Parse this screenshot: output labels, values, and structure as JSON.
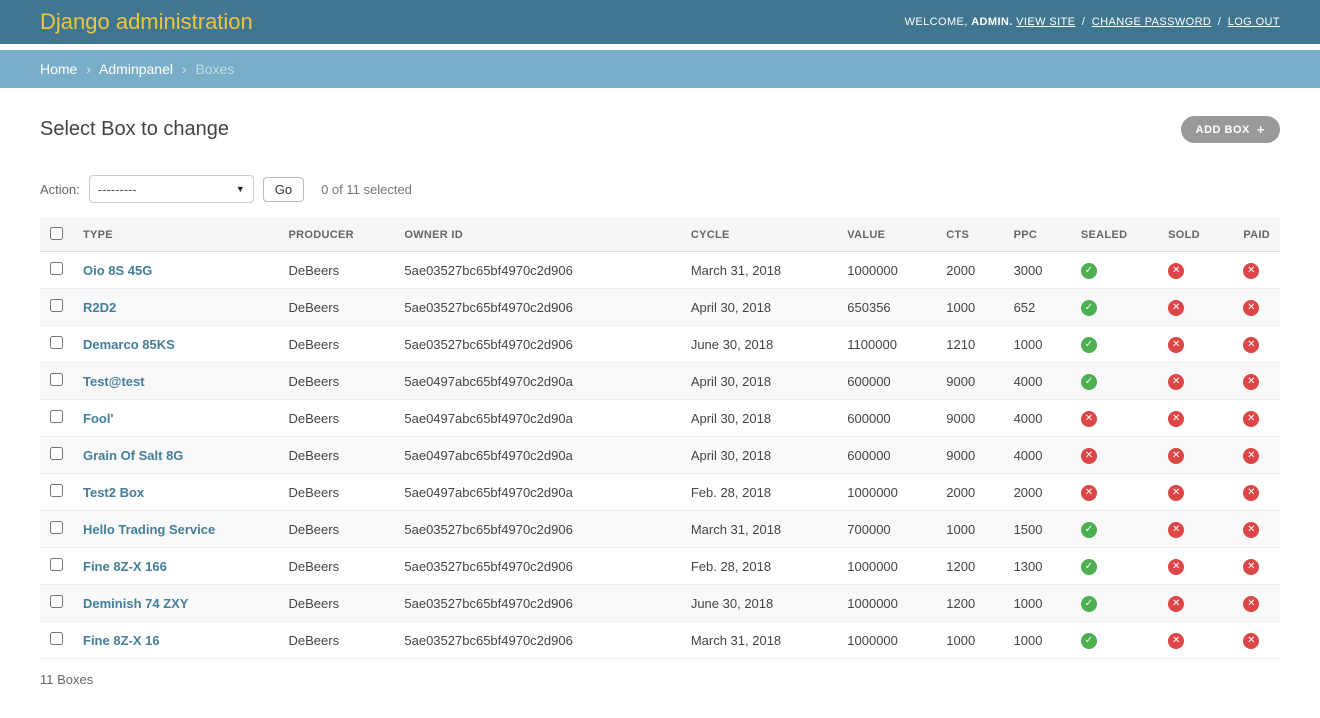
{
  "header": {
    "site_title": "Django administration",
    "user_tools": {
      "welcome": "WELCOME,",
      "username": "ADMIN.",
      "separator": "/",
      "links": [
        "VIEW SITE",
        "CHANGE PASSWORD",
        "LOG OUT"
      ]
    }
  },
  "breadcrumbs": {
    "separator": "›",
    "items": [
      "Home",
      "Adminpanel",
      "Boxes"
    ]
  },
  "page": {
    "title": "Select Box to change",
    "add_button_label": "ADD BOX",
    "add_button_icon": "+"
  },
  "actions": {
    "label": "Action:",
    "selected_option": "---------",
    "dropdown_caret": "▼",
    "go_label": "Go",
    "selection_note": "0 of 11 selected"
  },
  "table": {
    "columns": [
      "TYPE",
      "PRODUCER",
      "OWNER ID",
      "CYCLE",
      "VALUE",
      "CTS",
      "PPC",
      "SEALED",
      "SOLD",
      "PAID"
    ],
    "icons": {
      "yes_glyph": "✓",
      "no_glyph": "✕"
    },
    "rows": [
      {
        "type": "Oio 8S 45G",
        "producer": "DeBeers",
        "owner_id": "5ae03527bc65bf4970c2d906",
        "cycle": "March 31, 2018",
        "value": "1000000",
        "cts": "2000",
        "ppc": "3000",
        "sealed": true,
        "sold": false,
        "paid": false
      },
      {
        "type": "R2D2",
        "producer": "DeBeers",
        "owner_id": "5ae03527bc65bf4970c2d906",
        "cycle": "April 30, 2018",
        "value": "650356",
        "cts": "1000",
        "ppc": "652",
        "sealed": true,
        "sold": false,
        "paid": false
      },
      {
        "type": "Demarco 85KS",
        "producer": "DeBeers",
        "owner_id": "5ae03527bc65bf4970c2d906",
        "cycle": "June 30, 2018",
        "value": "1100000",
        "cts": "1210",
        "ppc": "1000",
        "sealed": true,
        "sold": false,
        "paid": false
      },
      {
        "type": "Test@test",
        "producer": "DeBeers",
        "owner_id": "5ae0497abc65bf4970c2d90a",
        "cycle": "April 30, 2018",
        "value": "600000",
        "cts": "9000",
        "ppc": "4000",
        "sealed": true,
        "sold": false,
        "paid": false
      },
      {
        "type": "Fool'",
        "producer": "DeBeers",
        "owner_id": "5ae0497abc65bf4970c2d90a",
        "cycle": "April 30, 2018",
        "value": "600000",
        "cts": "9000",
        "ppc": "4000",
        "sealed": false,
        "sold": false,
        "paid": false
      },
      {
        "type": "Grain Of Salt 8G",
        "producer": "DeBeers",
        "owner_id": "5ae0497abc65bf4970c2d90a",
        "cycle": "April 30, 2018",
        "value": "600000",
        "cts": "9000",
        "ppc": "4000",
        "sealed": false,
        "sold": false,
        "paid": false
      },
      {
        "type": "Test2 Box",
        "producer": "DeBeers",
        "owner_id": "5ae0497abc65bf4970c2d90a",
        "cycle": "Feb. 28, 2018",
        "value": "1000000",
        "cts": "2000",
        "ppc": "2000",
        "sealed": false,
        "sold": false,
        "paid": false
      },
      {
        "type": "Hello Trading Service",
        "producer": "DeBeers",
        "owner_id": "5ae03527bc65bf4970c2d906",
        "cycle": "March 31, 2018",
        "value": "700000",
        "cts": "1000",
        "ppc": "1500",
        "sealed": true,
        "sold": false,
        "paid": false
      },
      {
        "type": "Fine 8Z-X 166",
        "producer": "DeBeers",
        "owner_id": "5ae03527bc65bf4970c2d906",
        "cycle": "Feb. 28, 2018",
        "value": "1000000",
        "cts": "1200",
        "ppc": "1300",
        "sealed": true,
        "sold": false,
        "paid": false
      },
      {
        "type": "Deminish 74 ZXY",
        "producer": "DeBeers",
        "owner_id": "5ae03527bc65bf4970c2d906",
        "cycle": "June 30, 2018",
        "value": "1000000",
        "cts": "1200",
        "ppc": "1000",
        "sealed": true,
        "sold": false,
        "paid": false
      },
      {
        "type": "Fine 8Z-X 16",
        "producer": "DeBeers",
        "owner_id": "5ae03527bc65bf4970c2d906",
        "cycle": "March 31, 2018",
        "value": "1000000",
        "cts": "1000",
        "ppc": "1000",
        "sealed": true,
        "sold": false,
        "paid": false
      }
    ]
  },
  "footer": {
    "count_label": "11 Boxes"
  },
  "colors": {
    "header_bg": "#417690",
    "brand": "#eec43d",
    "breadcrumb_bg": "#79aec8",
    "link": "#447e9b",
    "yes_green": "#4caf50",
    "no_red": "#dd4646",
    "add_button_bg": "#999999"
  }
}
